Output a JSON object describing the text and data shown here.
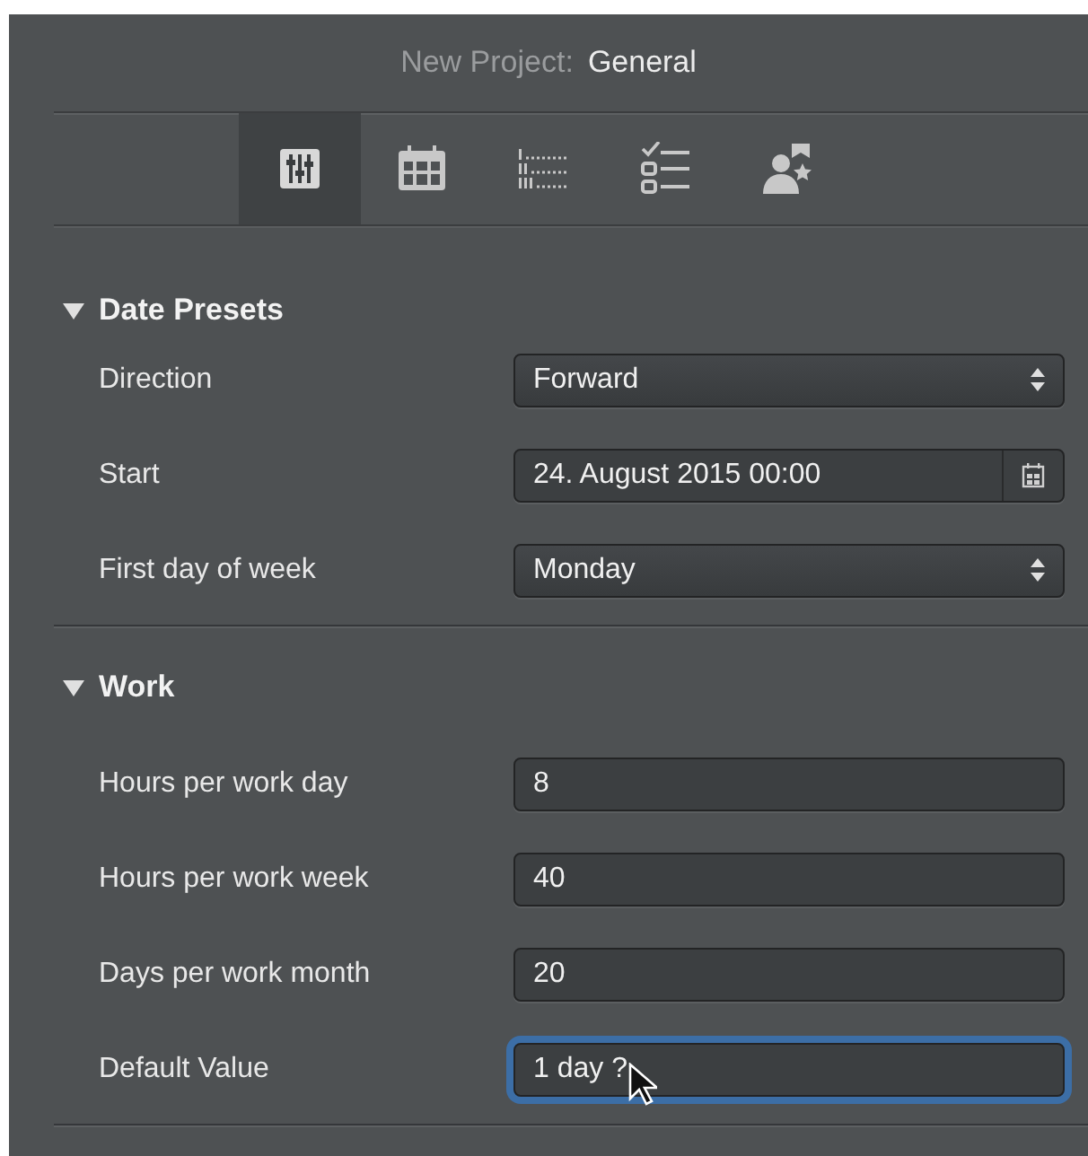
{
  "window": {
    "title_prefix": "New Project:",
    "title": "General"
  },
  "toolbar": [
    {
      "kind": "sliders",
      "selected": true
    },
    {
      "kind": "calendar",
      "selected": false
    },
    {
      "kind": "outline",
      "selected": false
    },
    {
      "kind": "checklist",
      "selected": false
    },
    {
      "kind": "person",
      "selected": false
    }
  ],
  "sections": [
    {
      "title": "Date Presets",
      "expanded": true,
      "rows": [
        {
          "label": "Direction",
          "kind": "popup",
          "value": "Forward"
        },
        {
          "label": "Start",
          "kind": "date",
          "value": "24. August 2015 00:00"
        },
        {
          "label": "First day of week",
          "kind": "popup",
          "value": "Monday"
        }
      ]
    },
    {
      "title": "Work",
      "expanded": true,
      "rows": [
        {
          "label": "Hours per work day",
          "kind": "text",
          "value": "8",
          "focused": false
        },
        {
          "label": "Hours per work week",
          "kind": "text",
          "value": "40",
          "focused": false
        },
        {
          "label": "Days per work month",
          "kind": "text",
          "value": "20",
          "focused": false
        },
        {
          "label": "Default Value",
          "kind": "text",
          "value": "1 day ?",
          "focused": true
        }
      ]
    }
  ]
}
